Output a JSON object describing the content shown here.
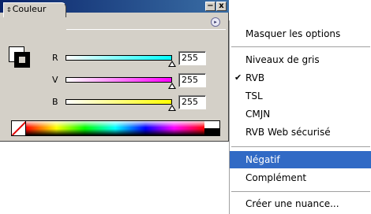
{
  "panel": {
    "tab_label": "Couleur",
    "tab_arrows_icon": "⇕",
    "window_buttons": {
      "minimize": "−",
      "close": "x"
    },
    "menu_button_icon": "▸",
    "channels": [
      {
        "label": "R",
        "value": "255",
        "gradient_start": "#ffffff",
        "gradient_end": "#00ffff",
        "level": 1.0
      },
      {
        "label": "V",
        "value": "255",
        "gradient_start": "#ffffff",
        "gradient_end": "#ff00ff",
        "level": 1.0
      },
      {
        "label": "B",
        "value": "255",
        "gradient_start": "#ffffff",
        "gradient_end": "#ffff00",
        "level": 1.0
      }
    ]
  },
  "menu": {
    "items": [
      {
        "label": "Masquer les options",
        "checked": false,
        "selected": false
      },
      {
        "label": "Niveaux de gris",
        "checked": false,
        "selected": false
      },
      {
        "label": "RVB",
        "checked": true,
        "selected": false
      },
      {
        "label": "TSL",
        "checked": false,
        "selected": false
      },
      {
        "label": "CMJN",
        "checked": false,
        "selected": false
      },
      {
        "label": "RVB Web sécurisé",
        "checked": false,
        "selected": false
      },
      {
        "label": "Négatif",
        "checked": false,
        "selected": true
      },
      {
        "label": "Complément",
        "checked": false,
        "selected": false
      },
      {
        "label": "Créer une nuance...",
        "checked": false,
        "selected": false
      }
    ],
    "check_mark": "✔"
  },
  "colors": {
    "selection": "#316ac5",
    "panel_bg": "#d4d0c8",
    "titlebar": "#0a246a"
  }
}
